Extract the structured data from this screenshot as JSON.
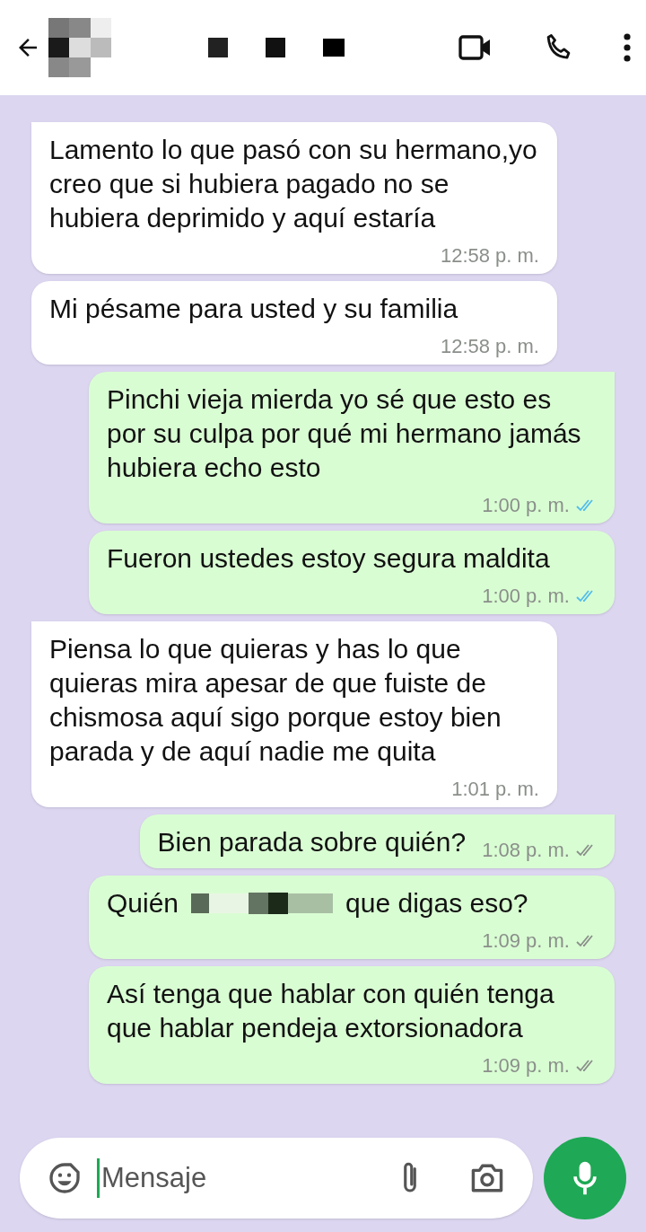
{
  "messages": [
    {
      "outgoing": false,
      "tail": true,
      "text": "Lamento lo que pasó con su hermano,yo creo que si hubiera pagado no se hubiera deprimido y aquí estaría",
      "time": "12:58 p. m."
    },
    {
      "outgoing": false,
      "tail": false,
      "text": "Mi pésame para usted y su familia",
      "time": "12:58 p. m."
    },
    {
      "outgoing": true,
      "tail": true,
      "text": "Pinchi vieja mierda yo sé que esto es por su culpa por qué mi hermano jamás hubiera echo esto",
      "time": "1:00 p. m.",
      "read": true
    },
    {
      "outgoing": true,
      "tail": false,
      "text": "Fueron ustedes estoy segura maldita",
      "time": "1:00 p. m.",
      "read": true
    },
    {
      "outgoing": false,
      "tail": true,
      "text": "Piensa lo que quieras y has lo que quieras mira apesar de que fuiste de chismosa aquí sigo porque estoy bien parada y de aquí nadie me quita",
      "time": "1:01 p. m."
    },
    {
      "outgoing": true,
      "tail": true,
      "text": "Bien parada sobre quién?",
      "time": "1:08 p. m.",
      "read": false
    },
    {
      "outgoing": true,
      "tail": false,
      "kind": "redacted",
      "text": "Quién",
      "text_after": "que digas eso?",
      "time": "1:09 p. m.",
      "read": false
    },
    {
      "outgoing": true,
      "tail": false,
      "text": "Así tenga que hablar con quién tenga que hablar pendeja extorsionadora",
      "time": "1:09 p. m.",
      "read": false
    }
  ],
  "composer": {
    "placeholder": "Mensaje"
  }
}
